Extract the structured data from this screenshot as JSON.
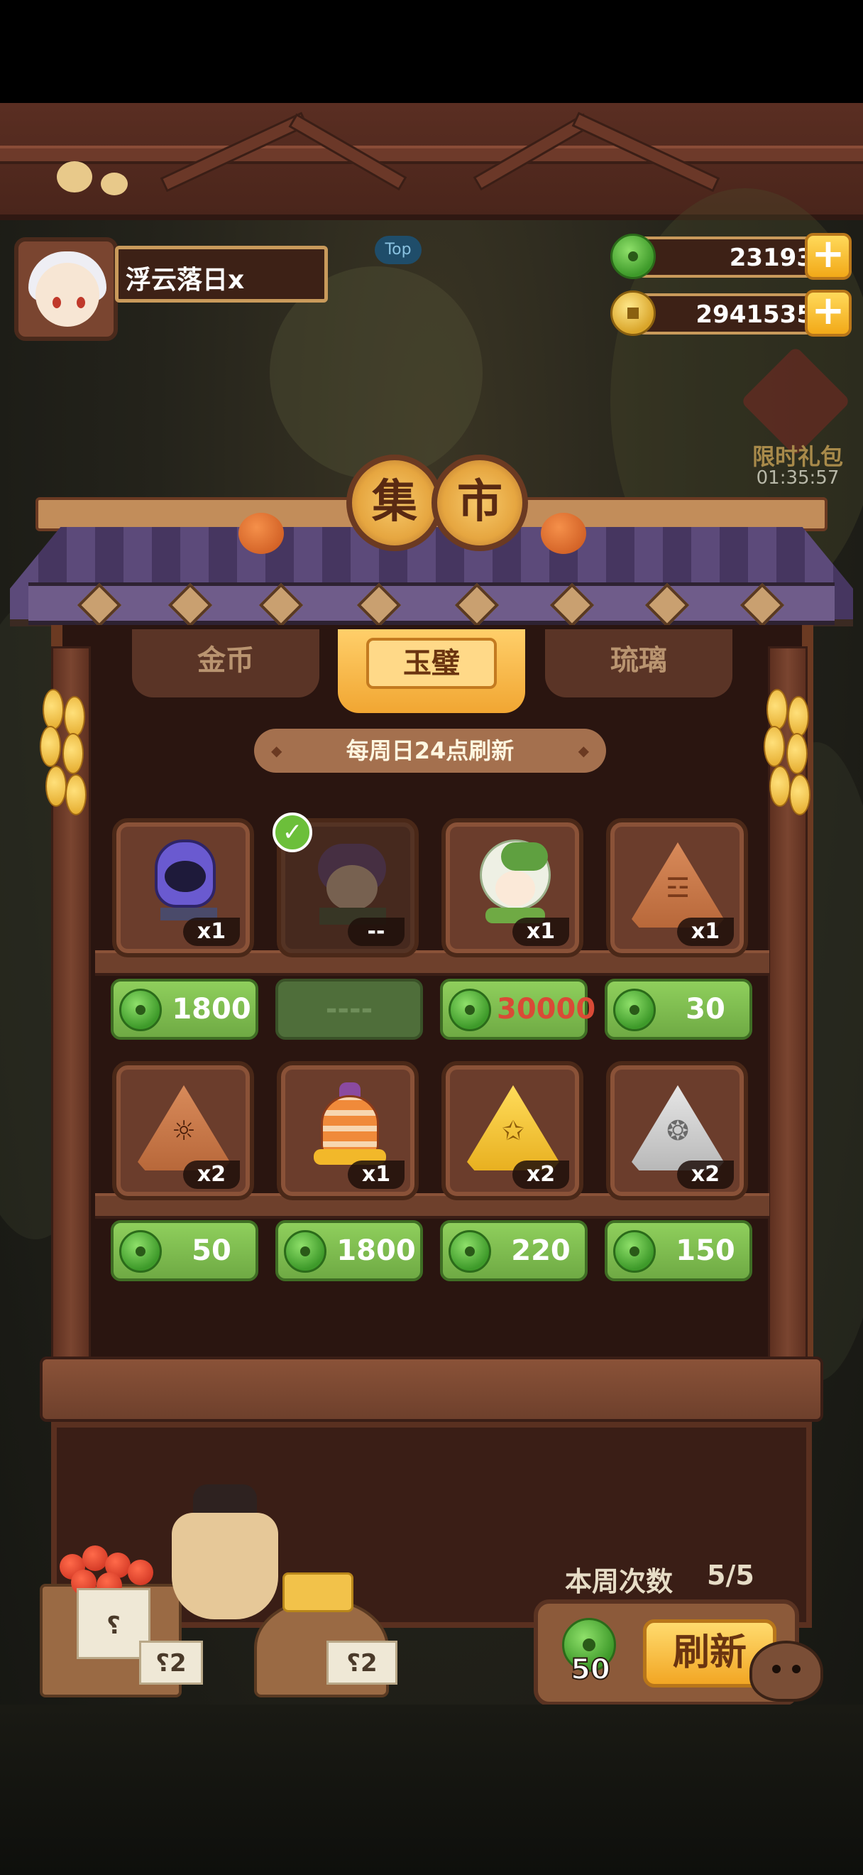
{
  "player": {
    "name": "浮云落日x"
  },
  "currencies": {
    "jade": "23193",
    "gold": "2941535"
  },
  "top_badge": "Top",
  "limited_gift": {
    "label": "限时礼包",
    "timer": "01:35:57"
  },
  "shop": {
    "title_chars": [
      "集",
      "市"
    ],
    "tabs": [
      {
        "label": "金币",
        "active": false
      },
      {
        "label": "玉璧",
        "active": true
      },
      {
        "label": "琉璃",
        "active": false
      }
    ],
    "refresh_note": "每周日24点刷新",
    "items": [
      {
        "qty": "x1",
        "price": "1800",
        "sold": false,
        "art": "purple-robot-icon"
      },
      {
        "qty": "--",
        "price": "----",
        "sold": true,
        "art": "purple-haired-character-icon"
      },
      {
        "qty": "x1",
        "price": "30000",
        "sold": false,
        "affordable": false,
        "art": "green-hood-character-icon"
      },
      {
        "qty": "x1",
        "price": "30",
        "sold": false,
        "art": "bronze-rune-stone-icon"
      },
      {
        "qty": "x2",
        "price": "50",
        "sold": false,
        "art": "sun-rune-stone-icon"
      },
      {
        "qty": "x1",
        "price": "1800",
        "sold": false,
        "art": "orange-urn-icon"
      },
      {
        "qty": "x2",
        "price": "220",
        "sold": false,
        "art": "gold-star-stone-icon"
      },
      {
        "qty": "x2",
        "price": "150",
        "sold": false,
        "art": "silver-rune-stone-icon"
      }
    ],
    "weekly_label": "本周次数",
    "weekly_count": "5/5",
    "refresh_cost": "50",
    "refresh_button": "刷新",
    "stall_signs": [
      "⸮",
      "⸮2",
      "⸮2"
    ]
  },
  "colors": {
    "price_green": "#7fbf4e",
    "tab_active": "#f5b84a",
    "roof_purple": "#5c4a7a",
    "wood": "#6b3a22",
    "unaffordable_red": "#d94a36"
  }
}
